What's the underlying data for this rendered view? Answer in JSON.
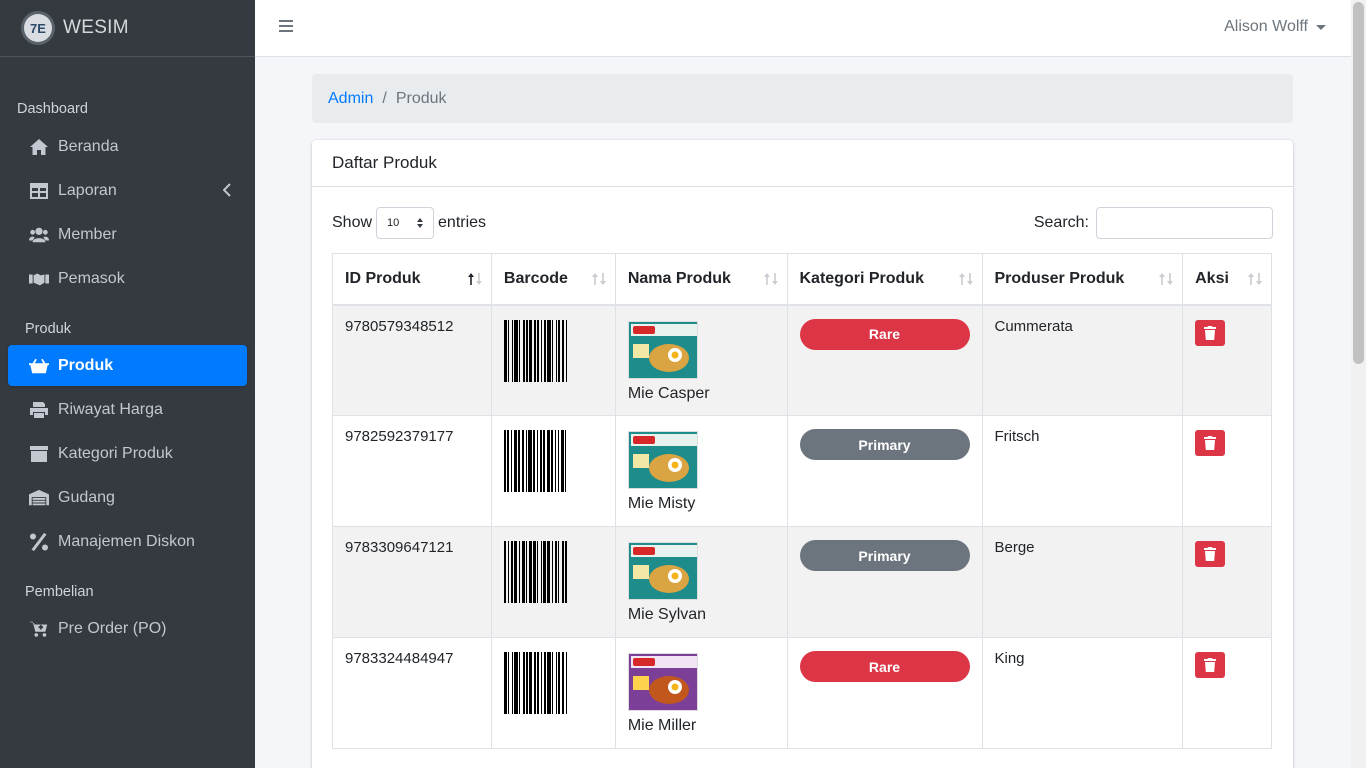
{
  "brand": {
    "name": "WESIM",
    "logo_text": "7E"
  },
  "sidebar": {
    "sections": [
      {
        "header": "Dashboard"
      },
      {
        "header": "Produk"
      },
      {
        "header": "Pembelian"
      }
    ],
    "items": [
      {
        "label": "Beranda",
        "icon": "home-icon"
      },
      {
        "label": "Laporan",
        "icon": "table-icon"
      },
      {
        "label": "Member",
        "icon": "users-icon"
      },
      {
        "label": "Pemasok",
        "icon": "handshake-icon"
      },
      {
        "label": "Produk",
        "icon": "basket-icon",
        "active": true
      },
      {
        "label": "Riwayat Harga",
        "icon": "print-icon"
      },
      {
        "label": "Kategori Produk",
        "icon": "archive-icon"
      },
      {
        "label": "Gudang",
        "icon": "warehouse-icon"
      },
      {
        "label": "Manajemen Diskon",
        "icon": "percent-icon"
      },
      {
        "label": "Pre Order (PO)",
        "icon": "cart-plus-icon"
      }
    ]
  },
  "topbar": {
    "user_name": "Alison Wolff"
  },
  "breadcrumb": {
    "parent": "Admin",
    "separator": "/",
    "current": "Produk"
  },
  "card": {
    "title": "Daftar Produk"
  },
  "controls": {
    "show_label": "Show",
    "entries_value": "10",
    "entries_label": "entries",
    "search_label": "Search:"
  },
  "table": {
    "columns": [
      "ID Produk",
      "Barcode",
      "Nama Produk",
      "Kategori Produk",
      "Produser Produk",
      "Aksi"
    ],
    "rows": [
      {
        "id": "9780579348512",
        "name": "Mie Casper",
        "category": "Rare",
        "category_color": "#dc3545",
        "producer": "Cummerata",
        "image": "noodle-teal-pack"
      },
      {
        "id": "9782592379177",
        "name": "Mie Misty",
        "category": "Primary",
        "category_color": "#6c757d",
        "producer": "Fritsch",
        "image": "noodle-teal-pack"
      },
      {
        "id": "9783309647121",
        "name": "Mie Sylvan",
        "category": "Primary",
        "category_color": "#6c757d",
        "producer": "Berge",
        "image": "noodle-teal-pack"
      },
      {
        "id": "9783324484947",
        "name": "Mie Miller",
        "category": "Rare",
        "category_color": "#dc3545",
        "producer": "King",
        "image": "noodle-purple-pack"
      }
    ]
  },
  "colors": {
    "primary": "#007bff",
    "danger": "#dc3545",
    "secondary": "#6c757d",
    "sidebar_bg": "#343a40"
  }
}
